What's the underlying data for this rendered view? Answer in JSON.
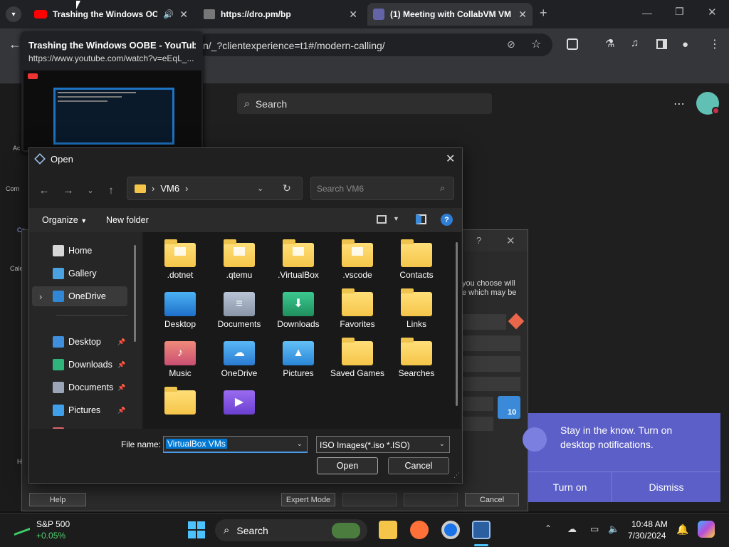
{
  "browser": {
    "tabs": [
      {
        "title": "Trashing the Windows OOBE - YouTube"
      },
      {
        "title": "https://dro.pm/bp"
      },
      {
        "title": "(1) Meeting with CollabVM VM"
      }
    ],
    "address_fragment": "n/_?clientexperience=t1#/modern-calling/",
    "hovercard": {
      "title": "Trashing the Windows OOBE - YouTube",
      "url": "https://www.youtube.com/watch?v=eEqL_..."
    }
  },
  "teams": {
    "search_placeholder": "Search",
    "rail_labels": [
      "Ac",
      "Com",
      "Ca",
      "Cale",
      "H"
    ]
  },
  "vbox": {
    "help": "Help",
    "expert": "Expert Mode",
    "cancel": "Cancel",
    "text_line1": "you choose will",
    "text_line2": "e which may be",
    "badge": "10"
  },
  "notification": {
    "text": "Stay in the know. Turn on desktop notifications.",
    "turn_on": "Turn on",
    "dismiss": "Dismiss"
  },
  "open_dialog": {
    "title": "Open",
    "path": "VM6",
    "search_placeholder": "Search VM6",
    "organize": "Organize",
    "new_folder": "New folder",
    "nav": [
      {
        "label": "Home",
        "color": "#d6d6d6"
      },
      {
        "label": "Gallery",
        "color": "#4aa3e0"
      },
      {
        "label": "OneDrive",
        "color": "#2f87d6",
        "selected": true
      },
      {
        "label": "Desktop",
        "color": "#3f8fdd",
        "pinned": true
      },
      {
        "label": "Downloads",
        "color": "#2fb57b",
        "pinned": true
      },
      {
        "label": "Documents",
        "color": "#9aa6b8",
        "pinned": true
      },
      {
        "label": "Pictures",
        "color": "#3f9fe8",
        "pinned": true
      },
      {
        "label": "Music",
        "color": "#e0656b",
        "pinned": true
      }
    ],
    "files": [
      {
        "label": ".dotnet",
        "kind": "doc"
      },
      {
        "label": ".qtemu",
        "kind": "doc"
      },
      {
        "label": ".VirtualBox",
        "kind": "doc"
      },
      {
        "label": ".vscode",
        "kind": "doc"
      },
      {
        "label": "Contacts",
        "kind": "folder"
      },
      {
        "label": "Desktop",
        "kind": "desktop"
      },
      {
        "label": "Documents",
        "kind": "documents"
      },
      {
        "label": "Downloads",
        "kind": "downloads"
      },
      {
        "label": "Favorites",
        "kind": "folder"
      },
      {
        "label": "Links",
        "kind": "folder"
      },
      {
        "label": "Music",
        "kind": "music"
      },
      {
        "label": "OneDrive",
        "kind": "onedrive"
      },
      {
        "label": "Pictures",
        "kind": "pictures"
      },
      {
        "label": "Saved Games",
        "kind": "folder"
      },
      {
        "label": "Searches",
        "kind": "folder"
      },
      {
        "label": "",
        "kind": "folder"
      },
      {
        "label": "",
        "kind": "videos"
      }
    ],
    "file_name_label": "File name:",
    "file_name_value": "VirtualBox VMs",
    "file_type": "ISO Images(*.iso *.ISO)",
    "open_button": "Open",
    "cancel_button": "Cancel"
  },
  "taskbar": {
    "stock_name": "S&P 500",
    "stock_change": "+0.05%",
    "search": "Search",
    "time": "10:48 AM",
    "date": "7/30/2024"
  }
}
